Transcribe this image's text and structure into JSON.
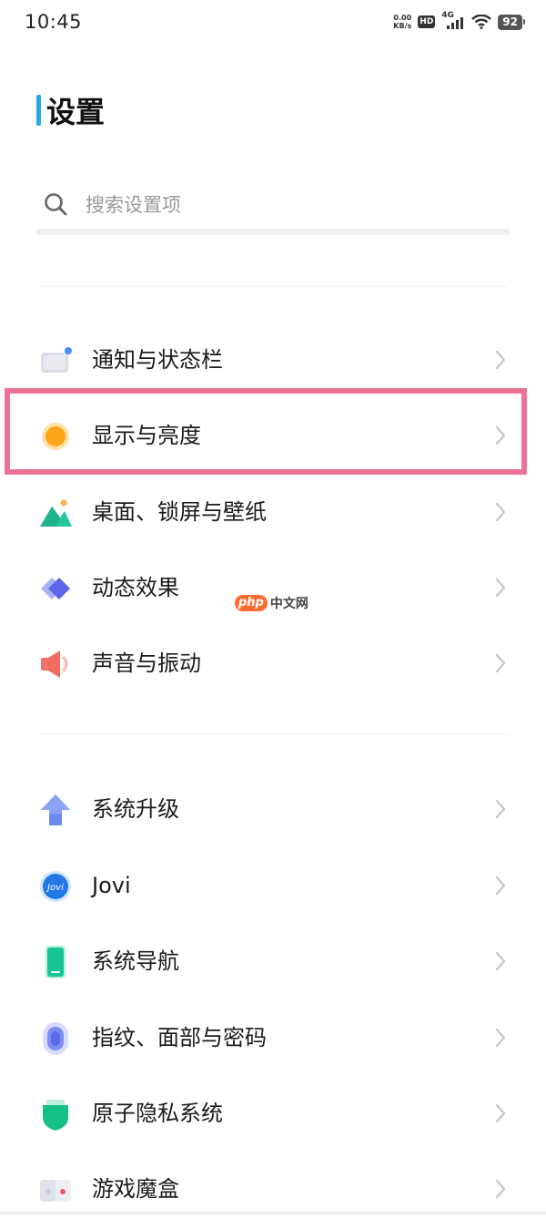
{
  "status_bar": {
    "time": "10:45",
    "net_speed_value": "0.00",
    "net_speed_unit": "KB/s",
    "hd": "HD",
    "network": "4G",
    "battery": "92"
  },
  "header": {
    "title": "设置"
  },
  "search": {
    "placeholder": "搜索设置项"
  },
  "groups": [
    {
      "items": [
        {
          "label": "通知与状态栏",
          "icon": "notification-bar-icon"
        },
        {
          "label": "显示与亮度",
          "icon": "display-brightness-icon",
          "highlighted": true
        },
        {
          "label": "桌面、锁屏与壁纸",
          "icon": "wallpaper-icon"
        },
        {
          "label": "动态效果",
          "icon": "motion-effects-icon"
        },
        {
          "label": "声音与振动",
          "icon": "sound-icon"
        }
      ]
    },
    {
      "items": [
        {
          "label": "系统升级",
          "icon": "system-upgrade-icon"
        },
        {
          "label": "Jovi",
          "icon": "jovi-icon"
        },
        {
          "label": "系统导航",
          "icon": "system-navigation-icon"
        },
        {
          "label": "指纹、面部与密码",
          "icon": "fingerprint-icon"
        },
        {
          "label": "原子隐私系统",
          "icon": "privacy-shield-icon"
        },
        {
          "label": "游戏魔盒",
          "icon": "game-box-icon"
        }
      ]
    }
  ],
  "watermark": {
    "logo": "php",
    "text": "中文网"
  },
  "colors": {
    "title_accent": "#25a9e8",
    "highlight_border": "#ec7396"
  }
}
